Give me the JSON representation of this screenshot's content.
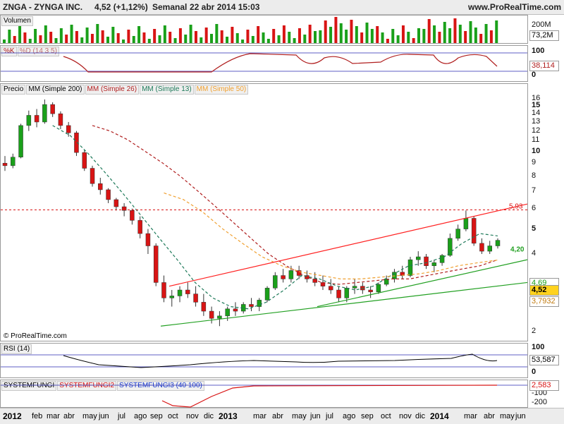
{
  "header": {
    "symbol": "ZNGA - ZYNGA INC.",
    "quote": "4,52 (+1,12%)",
    "period": "Semanal",
    "date": "22 abr 2014 15:03",
    "site": "www.ProRealTime.com"
  },
  "watermark": "© ProRealTime.com",
  "colors": {
    "up": "#1aa01a",
    "down": "#d81414",
    "ma200": "#000000",
    "ma26": "#b01e1e",
    "ma13": "#1e7a5a",
    "ma50": "#f0a030",
    "trend_red": "#ff2020",
    "trend_green": "#22a022",
    "rsi": "#000000",
    "k": "#b01e1e",
    "d": "#c07070"
  },
  "panels": {
    "volume": {
      "label": "Volumen",
      "ticks": [
        "200M"
      ],
      "value_box": "73,2M"
    },
    "stoch": {
      "labels": [
        "%K",
        "%D (14 3 5)"
      ],
      "ticks": [
        "100",
        "0"
      ],
      "value_box": "38,114"
    },
    "price": {
      "labels": [
        "Precio",
        "MM (Simple 200)",
        "MM (Simple 26)",
        "MM (Simple 13)",
        "MM (Simple 50)"
      ],
      "ticks": [
        "16",
        "15",
        "14",
        "13",
        "12",
        "11",
        "10",
        "9",
        "8",
        "7",
        "6",
        "5",
        "4",
        "3",
        "2"
      ],
      "level_label": "5,93",
      "trend_label": "4,20",
      "value_boxes": [
        "4,69",
        "4,52",
        "3,7932"
      ]
    },
    "rsi": {
      "label": "RSI (14)",
      "ticks": [
        "100",
        "0"
      ],
      "value_box": "53,587"
    },
    "fungi": {
      "labels": [
        "SYSTEMFUNGI",
        "SYSTEMFUNGI2",
        "SYSTEMFUNGI3 (40 100)"
      ],
      "ticks": [
        "0",
        "-100",
        "-200"
      ],
      "value_box": "2,583"
    }
  },
  "x_axis": {
    "labels": [
      "2012",
      "feb",
      "mar",
      "abr",
      "may",
      "jun",
      "jul",
      "ago",
      "sep",
      "oct",
      "nov",
      "dic",
      "2013",
      "mar",
      "abr",
      "may",
      "jun",
      "jul",
      "ago",
      "sep",
      "oct",
      "nov",
      "dic",
      "2014",
      "mar",
      "abr",
      "may",
      "jun"
    ]
  },
  "chart_data": {
    "type": "candlestick",
    "y_scale": "log",
    "ylim": [
      1.8,
      17
    ],
    "x_range": [
      "2012-01",
      "2014-06"
    ],
    "price_ohlc": [
      [
        9.0,
        9.6,
        8.4,
        8.8
      ],
      [
        8.8,
        9.8,
        8.6,
        9.5
      ],
      [
        9.5,
        12.8,
        9.4,
        12.6
      ],
      [
        12.6,
        14.4,
        12.0,
        13.8
      ],
      [
        13.8,
        14.6,
        12.4,
        13.0
      ],
      [
        13.0,
        15.9,
        12.8,
        15.2
      ],
      [
        15.2,
        15.5,
        13.6,
        14.0
      ],
      [
        14.0,
        14.3,
        12.2,
        12.6
      ],
      [
        12.6,
        13.0,
        11.4,
        11.8
      ],
      [
        11.8,
        12.0,
        9.6,
        9.9
      ],
      [
        9.9,
        10.1,
        8.4,
        8.6
      ],
      [
        8.6,
        8.8,
        7.3,
        7.5
      ],
      [
        7.5,
        7.9,
        6.8,
        7.1
      ],
      [
        7.1,
        7.2,
        6.3,
        6.5
      ],
      [
        6.5,
        6.6,
        5.9,
        6.1
      ],
      [
        6.1,
        6.3,
        5.6,
        5.9
      ],
      [
        5.9,
        6.0,
        5.2,
        5.4
      ],
      [
        5.4,
        5.6,
        4.6,
        4.8
      ],
      [
        4.8,
        5.0,
        4.0,
        4.3
      ],
      [
        4.3,
        4.4,
        3.0,
        3.1
      ],
      [
        3.1,
        3.3,
        2.6,
        2.7
      ],
      [
        2.7,
        2.9,
        2.5,
        2.75
      ],
      [
        2.75,
        3.0,
        2.6,
        2.9
      ],
      [
        2.9,
        3.1,
        2.7,
        2.8
      ],
      [
        2.8,
        3.0,
        2.5,
        2.6
      ],
      [
        2.6,
        2.8,
        2.3,
        2.4
      ],
      [
        2.4,
        2.5,
        2.15,
        2.25
      ],
      [
        2.25,
        2.4,
        2.1,
        2.3
      ],
      [
        2.3,
        2.5,
        2.2,
        2.45
      ],
      [
        2.45,
        2.6,
        2.3,
        2.4
      ],
      [
        2.4,
        2.6,
        2.35,
        2.55
      ],
      [
        2.55,
        2.7,
        2.4,
        2.5
      ],
      [
        2.5,
        2.7,
        2.4,
        2.65
      ],
      [
        2.65,
        3.0,
        2.6,
        2.95
      ],
      [
        2.95,
        3.4,
        2.9,
        3.3
      ],
      [
        3.3,
        3.5,
        3.1,
        3.2
      ],
      [
        3.2,
        3.6,
        3.1,
        3.45
      ],
      [
        3.45,
        3.6,
        3.2,
        3.3
      ],
      [
        3.3,
        3.45,
        3.1,
        3.2
      ],
      [
        3.2,
        3.4,
        3.0,
        3.1
      ],
      [
        3.1,
        3.3,
        2.9,
        3.0
      ],
      [
        3.0,
        3.2,
        2.8,
        2.9
      ],
      [
        2.9,
        3.0,
        2.6,
        2.7
      ],
      [
        2.7,
        3.0,
        2.6,
        2.95
      ],
      [
        2.95,
        3.2,
        2.8,
        3.0
      ],
      [
        3.0,
        3.1,
        2.8,
        2.9
      ],
      [
        2.9,
        3.0,
        2.7,
        2.85
      ],
      [
        2.85,
        3.1,
        2.8,
        3.05
      ],
      [
        3.05,
        3.3,
        3.0,
        3.2
      ],
      [
        3.2,
        3.5,
        3.1,
        3.4
      ],
      [
        3.4,
        3.6,
        3.2,
        3.3
      ],
      [
        3.3,
        3.9,
        3.25,
        3.8
      ],
      [
        3.8,
        4.1,
        3.6,
        3.9
      ],
      [
        3.9,
        4.0,
        3.5,
        3.6
      ],
      [
        3.6,
        3.8,
        3.4,
        3.7
      ],
      [
        3.7,
        4.0,
        3.6,
        3.95
      ],
      [
        3.95,
        4.8,
        3.9,
        4.6
      ],
      [
        4.6,
        5.2,
        4.5,
        5.0
      ],
      [
        5.0,
        5.9,
        4.9,
        5.5
      ],
      [
        5.5,
        5.6,
        4.3,
        4.4
      ],
      [
        4.4,
        4.6,
        4.0,
        4.1
      ],
      [
        4.1,
        4.5,
        4.0,
        4.3
      ],
      [
        4.3,
        4.6,
        4.2,
        4.52
      ]
    ],
    "series": [
      {
        "name": "MM (Simple 26)",
        "values": [
          12.6,
          12.0,
          11.1,
          10.0,
          9.0,
          8.0,
          7.0,
          6.1,
          5.3,
          4.6,
          4.0,
          3.6,
          3.3,
          3.1,
          3.05,
          3.1,
          3.15,
          3.2,
          3.2,
          3.3,
          3.4,
          3.5,
          3.6,
          3.8
        ]
      },
      {
        "name": "MM (Simple 13)",
        "values": [
          12.6,
          11.5,
          9.8,
          8.2,
          6.8,
          5.6,
          4.6,
          3.8,
          3.1,
          2.7,
          2.5,
          2.45,
          2.6,
          2.9,
          3.3,
          3.2,
          3.0,
          2.9,
          3.0,
          3.3,
          3.6,
          3.7,
          3.9,
          4.4,
          4.8,
          4.7
        ]
      },
      {
        "name": "MM (Simple 50)",
        "values": [
          6.9,
          6.5,
          5.8,
          5.0,
          4.4,
          3.9,
          3.6,
          3.4,
          3.3,
          3.2,
          3.2,
          3.25,
          3.3,
          3.35,
          3.45,
          3.6,
          3.7,
          3.79
        ]
      }
    ],
    "level_line": 5.93
  }
}
